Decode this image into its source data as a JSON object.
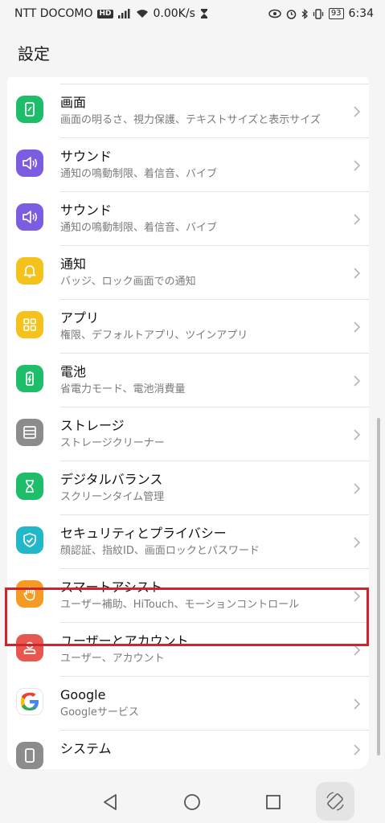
{
  "status": {
    "carrier": "NTT DOCOMO",
    "hd": "HD",
    "speed": "0.00K/s",
    "battery": "93",
    "time": "6:34"
  },
  "header": {
    "title": "設定"
  },
  "items": [
    {
      "title": "画面",
      "sub": "画面の明るさ、視力保護、テキストサイズと表示サイズ",
      "color": "#1ebd6a",
      "icon": "display-icon"
    },
    {
      "title": "サウンド",
      "sub": "通知の鳴動制限、着信音、バイブ",
      "color": "#7c5ce0",
      "icon": "speaker-icon"
    },
    {
      "title": "サウンド",
      "sub": "通知の鳴動制限、着信音、バイブ",
      "color": "#7c5ce0",
      "icon": "speaker-icon"
    },
    {
      "title": "通知",
      "sub": "バッジ、ロック画面での通知",
      "color": "#f5c21b",
      "icon": "bell-icon"
    },
    {
      "title": "アプリ",
      "sub": "権限、デフォルトアプリ、ツインアプリ",
      "color": "#f5c21b",
      "icon": "apps-grid-icon"
    },
    {
      "title": "電池",
      "sub": "省電力モード、電池消費量",
      "color": "#1ebd6a",
      "icon": "battery-icon"
    },
    {
      "title": "ストレージ",
      "sub": "ストレージクリーナー",
      "color": "#8c8c8c",
      "icon": "storage-icon"
    },
    {
      "title": "デジタルバランス",
      "sub": "スクリーンタイム管理",
      "color": "#1ebd6a",
      "icon": "hourglass-icon"
    },
    {
      "title": "セキュリティとプライバシー",
      "sub": "顔認証、指紋ID、画面ロックとパスワード",
      "color": "#22b8c9",
      "icon": "shield-check-icon"
    },
    {
      "title": "スマートアシスト",
      "sub": "ユーザー補助、HiTouch、モーションコントロール",
      "color": "#f59a23",
      "icon": "hand-icon"
    },
    {
      "title": "ユーザーとアカウント",
      "sub": "ユーザー、アカウント",
      "color": "#e8574f",
      "icon": "user-icon"
    },
    {
      "title": "Google",
      "sub": "Googleサービス",
      "color": "#ffffff",
      "icon": "google-icon"
    },
    {
      "title": "システム",
      "sub": "",
      "color": "#8c8c8c",
      "icon": "phone-icon"
    }
  ]
}
